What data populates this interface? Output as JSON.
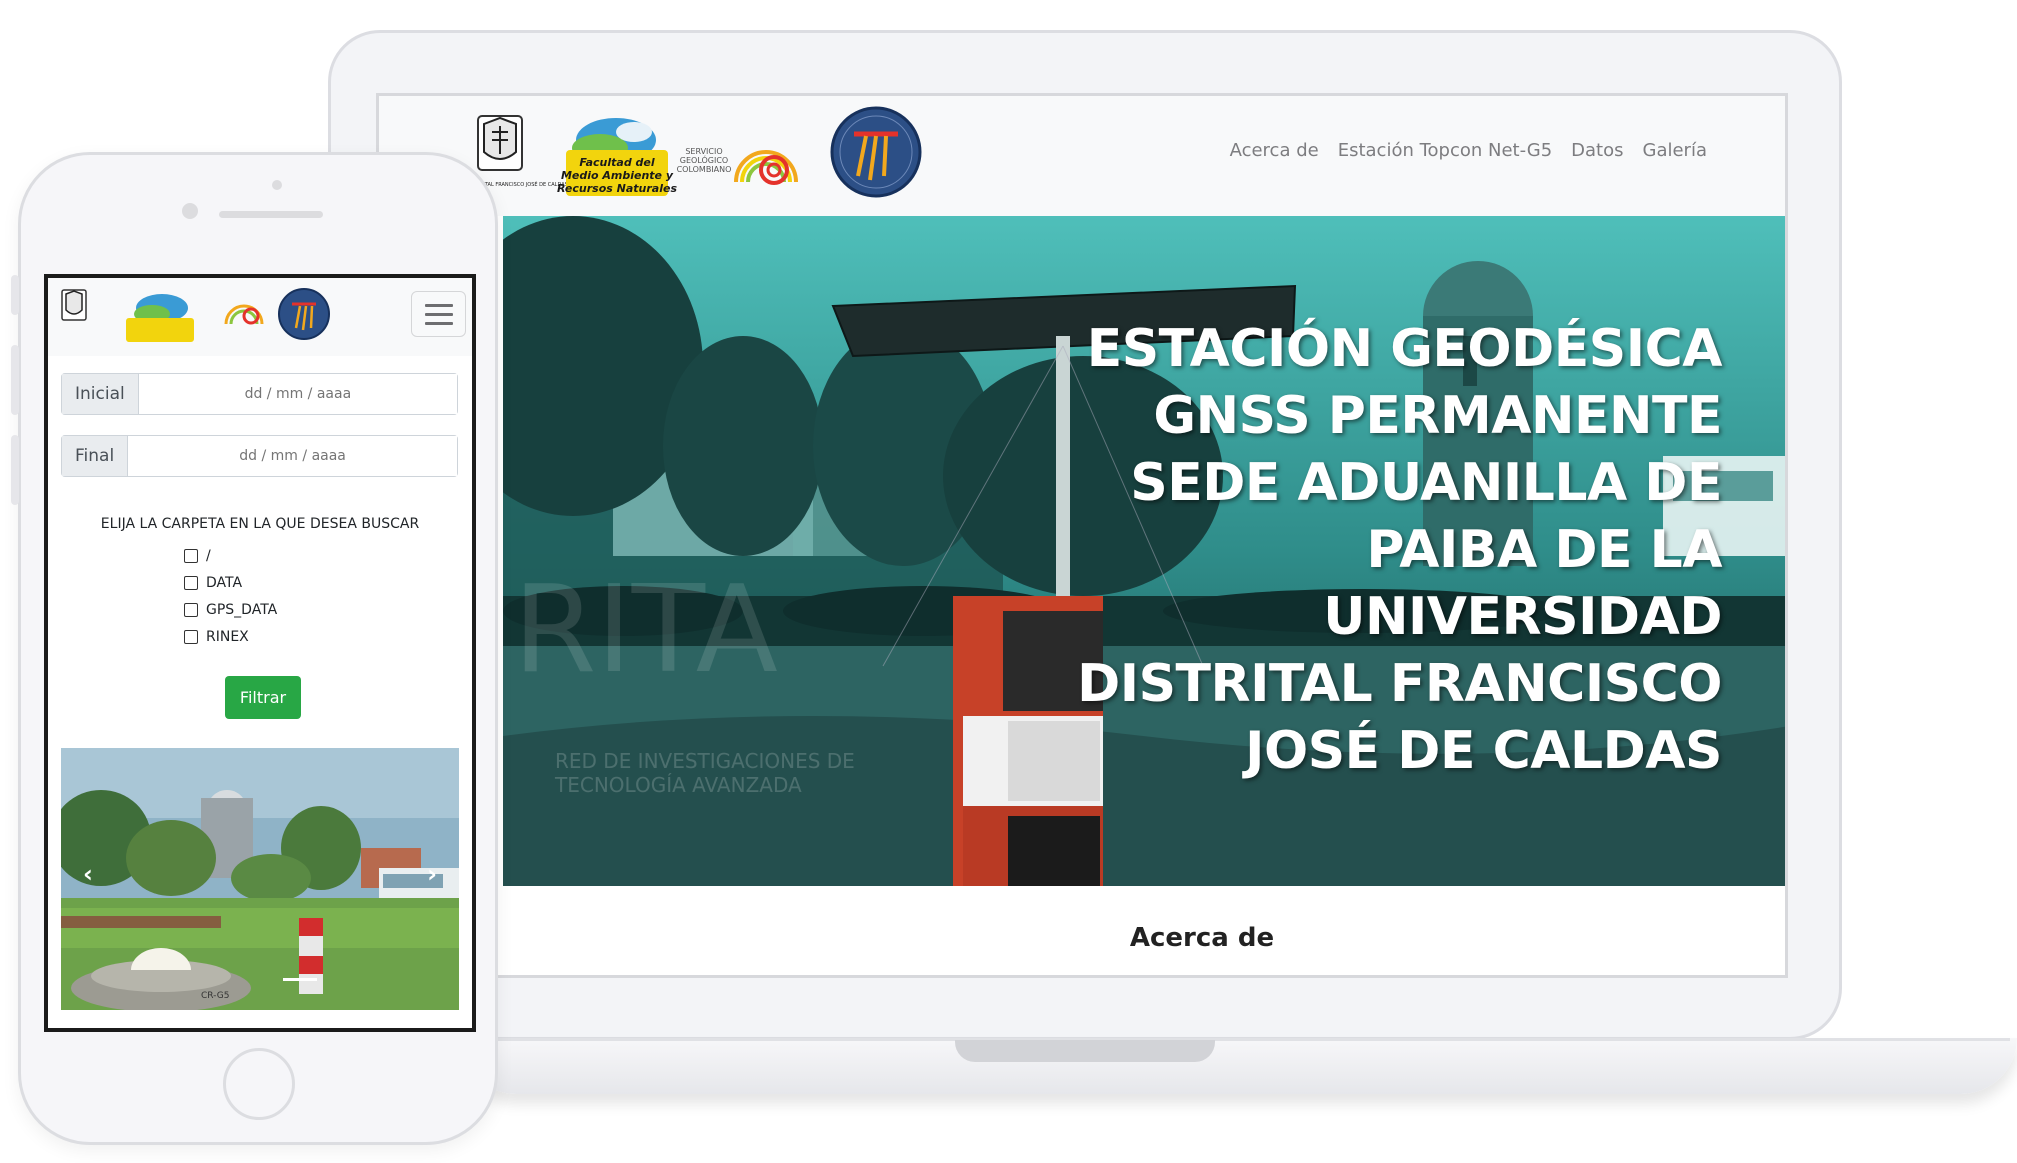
{
  "desktop": {
    "nav_links": [
      "Acerca de",
      "Estación Topcon Net-G5",
      "Datos",
      "Galería"
    ],
    "hero_title": "ESTACIÓN GEODÉSICA GNSS PERMANENTE SEDE ADUANILLA DE PAIBA DE LA UNIVERSIDAD DISTRITAL FRANCISCO JOSÉ DE CALDAS",
    "watermark_big": "RITA",
    "watermark_line1": "RED DE INVESTIGACIONES DE",
    "watermark_line2": "TECNOLOGÍA AVANZADA",
    "about_heading": "Acerca de"
  },
  "logos": {
    "university_text": "UNIVERSIDAD DISTRITAL FRANCISCO JOSÉ DE CALDAS",
    "faculty_line1": "Facultad del",
    "faculty_line2": "Medio Ambiente y",
    "faculty_line3": "Recursos Naturales",
    "sgc_line1": "SERVICIO",
    "sgc_line2": "GEOLÓGICO",
    "sgc_line3": "COLOMBIANO"
  },
  "mobile": {
    "initial_label": "Inicial",
    "initial_placeholder": "dd / mm / aaaa",
    "final_label": "Final",
    "final_placeholder": "dd / mm / aaaa",
    "folder_prompt": "ELIJA LA CARPETA EN LA QUE DESEA BUSCAR",
    "folders": [
      "/",
      "DATA",
      "GPS_DATA",
      "RINEX"
    ],
    "filter_button": "Filtrar",
    "carousel_prev": "‹",
    "carousel_next": "›",
    "carousel_equipment_label": "CR-G5"
  },
  "colors": {
    "hero_tint": "#1f5c59",
    "button_green": "#28a745",
    "nav_text": "#7d7d80",
    "faculty_yellow": "#f2d40d",
    "sgc_red": "#e4322b"
  }
}
